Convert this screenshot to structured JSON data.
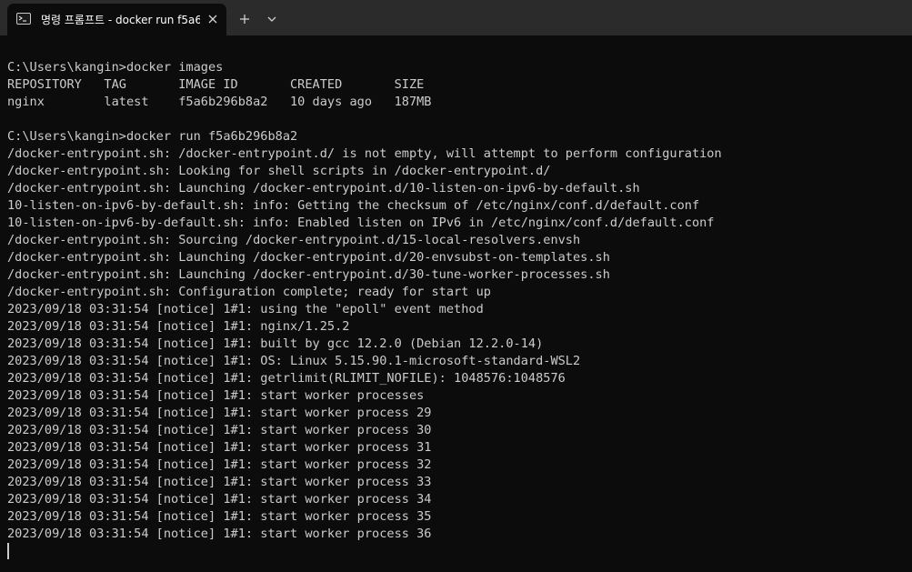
{
  "tab": {
    "title": "명령 프롬프트 - docker  run f5a6b296b8a2",
    "icon": "terminal-icon"
  },
  "titlebar": {
    "new_tab_icon": "plus-icon",
    "dropdown_icon": "chevron-down-icon",
    "close_icon": "close-icon"
  },
  "colors": {
    "terminal_bg": "#0c0c0c",
    "titlebar_bg": "#2b2b2b",
    "text": "#cccccc"
  },
  "terminal": {
    "lines": [
      "",
      "C:\\Users\\kangin>docker images",
      "REPOSITORY   TAG       IMAGE ID       CREATED       SIZE",
      "nginx        latest    f5a6b296b8a2   10 days ago   187MB",
      "",
      "C:\\Users\\kangin>docker run f5a6b296b8a2",
      "/docker-entrypoint.sh: /docker-entrypoint.d/ is not empty, will attempt to perform configuration",
      "/docker-entrypoint.sh: Looking for shell scripts in /docker-entrypoint.d/",
      "/docker-entrypoint.sh: Launching /docker-entrypoint.d/10-listen-on-ipv6-by-default.sh",
      "10-listen-on-ipv6-by-default.sh: info: Getting the checksum of /etc/nginx/conf.d/default.conf",
      "10-listen-on-ipv6-by-default.sh: info: Enabled listen on IPv6 in /etc/nginx/conf.d/default.conf",
      "/docker-entrypoint.sh: Sourcing /docker-entrypoint.d/15-local-resolvers.envsh",
      "/docker-entrypoint.sh: Launching /docker-entrypoint.d/20-envsubst-on-templates.sh",
      "/docker-entrypoint.sh: Launching /docker-entrypoint.d/30-tune-worker-processes.sh",
      "/docker-entrypoint.sh: Configuration complete; ready for start up",
      "2023/09/18 03:31:54 [notice] 1#1: using the \"epoll\" event method",
      "2023/09/18 03:31:54 [notice] 1#1: nginx/1.25.2",
      "2023/09/18 03:31:54 [notice] 1#1: built by gcc 12.2.0 (Debian 12.2.0-14)",
      "2023/09/18 03:31:54 [notice] 1#1: OS: Linux 5.15.90.1-microsoft-standard-WSL2",
      "2023/09/18 03:31:54 [notice] 1#1: getrlimit(RLIMIT_NOFILE): 1048576:1048576",
      "2023/09/18 03:31:54 [notice] 1#1: start worker processes",
      "2023/09/18 03:31:54 [notice] 1#1: start worker process 29",
      "2023/09/18 03:31:54 [notice] 1#1: start worker process 30",
      "2023/09/18 03:31:54 [notice] 1#1: start worker process 31",
      "2023/09/18 03:31:54 [notice] 1#1: start worker process 32",
      "2023/09/18 03:31:54 [notice] 1#1: start worker process 33",
      "2023/09/18 03:31:54 [notice] 1#1: start worker process 34",
      "2023/09/18 03:31:54 [notice] 1#1: start worker process 35",
      "2023/09/18 03:31:54 [notice] 1#1: start worker process 36"
    ]
  }
}
